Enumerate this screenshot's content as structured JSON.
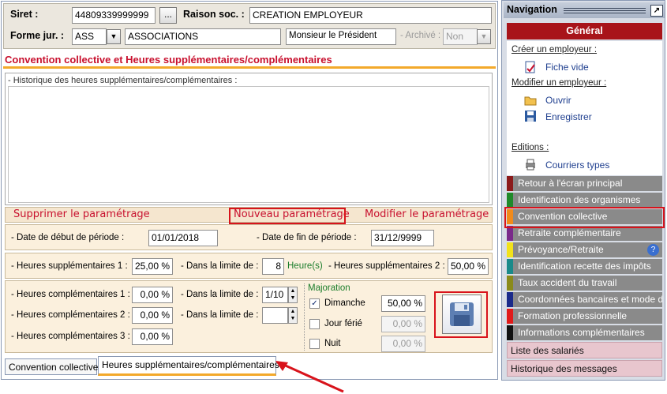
{
  "header": {
    "siret_label": "Siret :",
    "siret_value": "44809339999999",
    "browse_label": "...",
    "raison_label": "Raison soc. :",
    "raison_value": "CREATION EMPLOYEUR",
    "forme_label": "Forme jur. :",
    "forme_code": "ASS",
    "forme_name": "ASSOCIATIONS",
    "civility": "Monsieur le Président",
    "archive_label": "- Archivé :",
    "archive_value": "Non"
  },
  "page_title": "Convention collective et Heures supplémentaires/complémentaires",
  "history_label": "- Historique des heures supplémentaires/complémentaires :",
  "actions": {
    "delete": "Supprimer le paramétrage",
    "new": "Nouveau paramétrage",
    "modify": "Modifier le paramétrage"
  },
  "period": {
    "start_label": "- Date de début de période :",
    "start_value": "01/01/2018",
    "end_label": "- Date de fin de période :",
    "end_value": "31/12/9999"
  },
  "supp": {
    "hs1_label": "- Heures supplémentaires 1 :",
    "hs1_value": "25,00 %",
    "limit_label": "- Dans la limite de :",
    "limit_value": "8",
    "limit_unit": "Heure(s)",
    "hs2_label": "- Heures supplémentaires 2 :",
    "hs2_value": "50,00 %"
  },
  "comp": {
    "hc1_label": "- Heures complémentaires 1 :",
    "hc1_value": "0,00 %",
    "hc2_label": "- Heures complémentaires 2 :",
    "hc2_value": "0,00 %",
    "hc3_label": "- Heures complémentaires 3 :",
    "hc3_value": "0,00 %",
    "limit1_label": "- Dans la limite de :",
    "limit1_value": "1/10",
    "limit2_label": "- Dans la limite de :",
    "limit2_value": ""
  },
  "majoration": {
    "title": "Majoration",
    "dimanche_label": "Dimanche",
    "dimanche_checked": true,
    "dimanche_value": "50,00 %",
    "ferie_label": "Jour férié",
    "ferie_checked": false,
    "ferie_value": "0,00 %",
    "nuit_label": "Nuit",
    "nuit_checked": false,
    "nuit_value": "0,00 %"
  },
  "save_icon": "floppy-disk-icon",
  "tabs": [
    "Convention collective",
    "Heures supplémentaires/complémentaires"
  ],
  "nav": {
    "title": "Navigation",
    "general": "Général",
    "create_label": "Créer un employeur :",
    "blank_sheet": "Fiche vide",
    "modify_label": "Modifier un employeur :",
    "open": "Ouvrir",
    "save": "Enregistrer",
    "editions_label": "Editions :",
    "letters": "Courriers types",
    "items": [
      {
        "label": "Retour à l'écran principal",
        "color": "#8b1a1a"
      },
      {
        "label": "Identification des organismes",
        "color": "#1f8a2a"
      },
      {
        "label": "Convention collective",
        "color": "#f08a1a"
      },
      {
        "label": "Retraite complémentaire",
        "color": "#7a2a8a"
      },
      {
        "label": "Prévoyance/Retraite",
        "color": "#f2e21a"
      },
      {
        "label": "Identification recette des impôts",
        "color": "#1a8a8a"
      },
      {
        "label": "Taux accident du travail",
        "color": "#8a8a1a"
      },
      {
        "label": "Coordonnées bancaires et mode de",
        "color": "#1a2a8a"
      },
      {
        "label": "Formation professionnelle",
        "color": "#e01a1a"
      },
      {
        "label": "Informations complémentaires",
        "color": "#111111"
      }
    ],
    "employees": "Liste des salariés",
    "messages": "Historique des messages"
  }
}
